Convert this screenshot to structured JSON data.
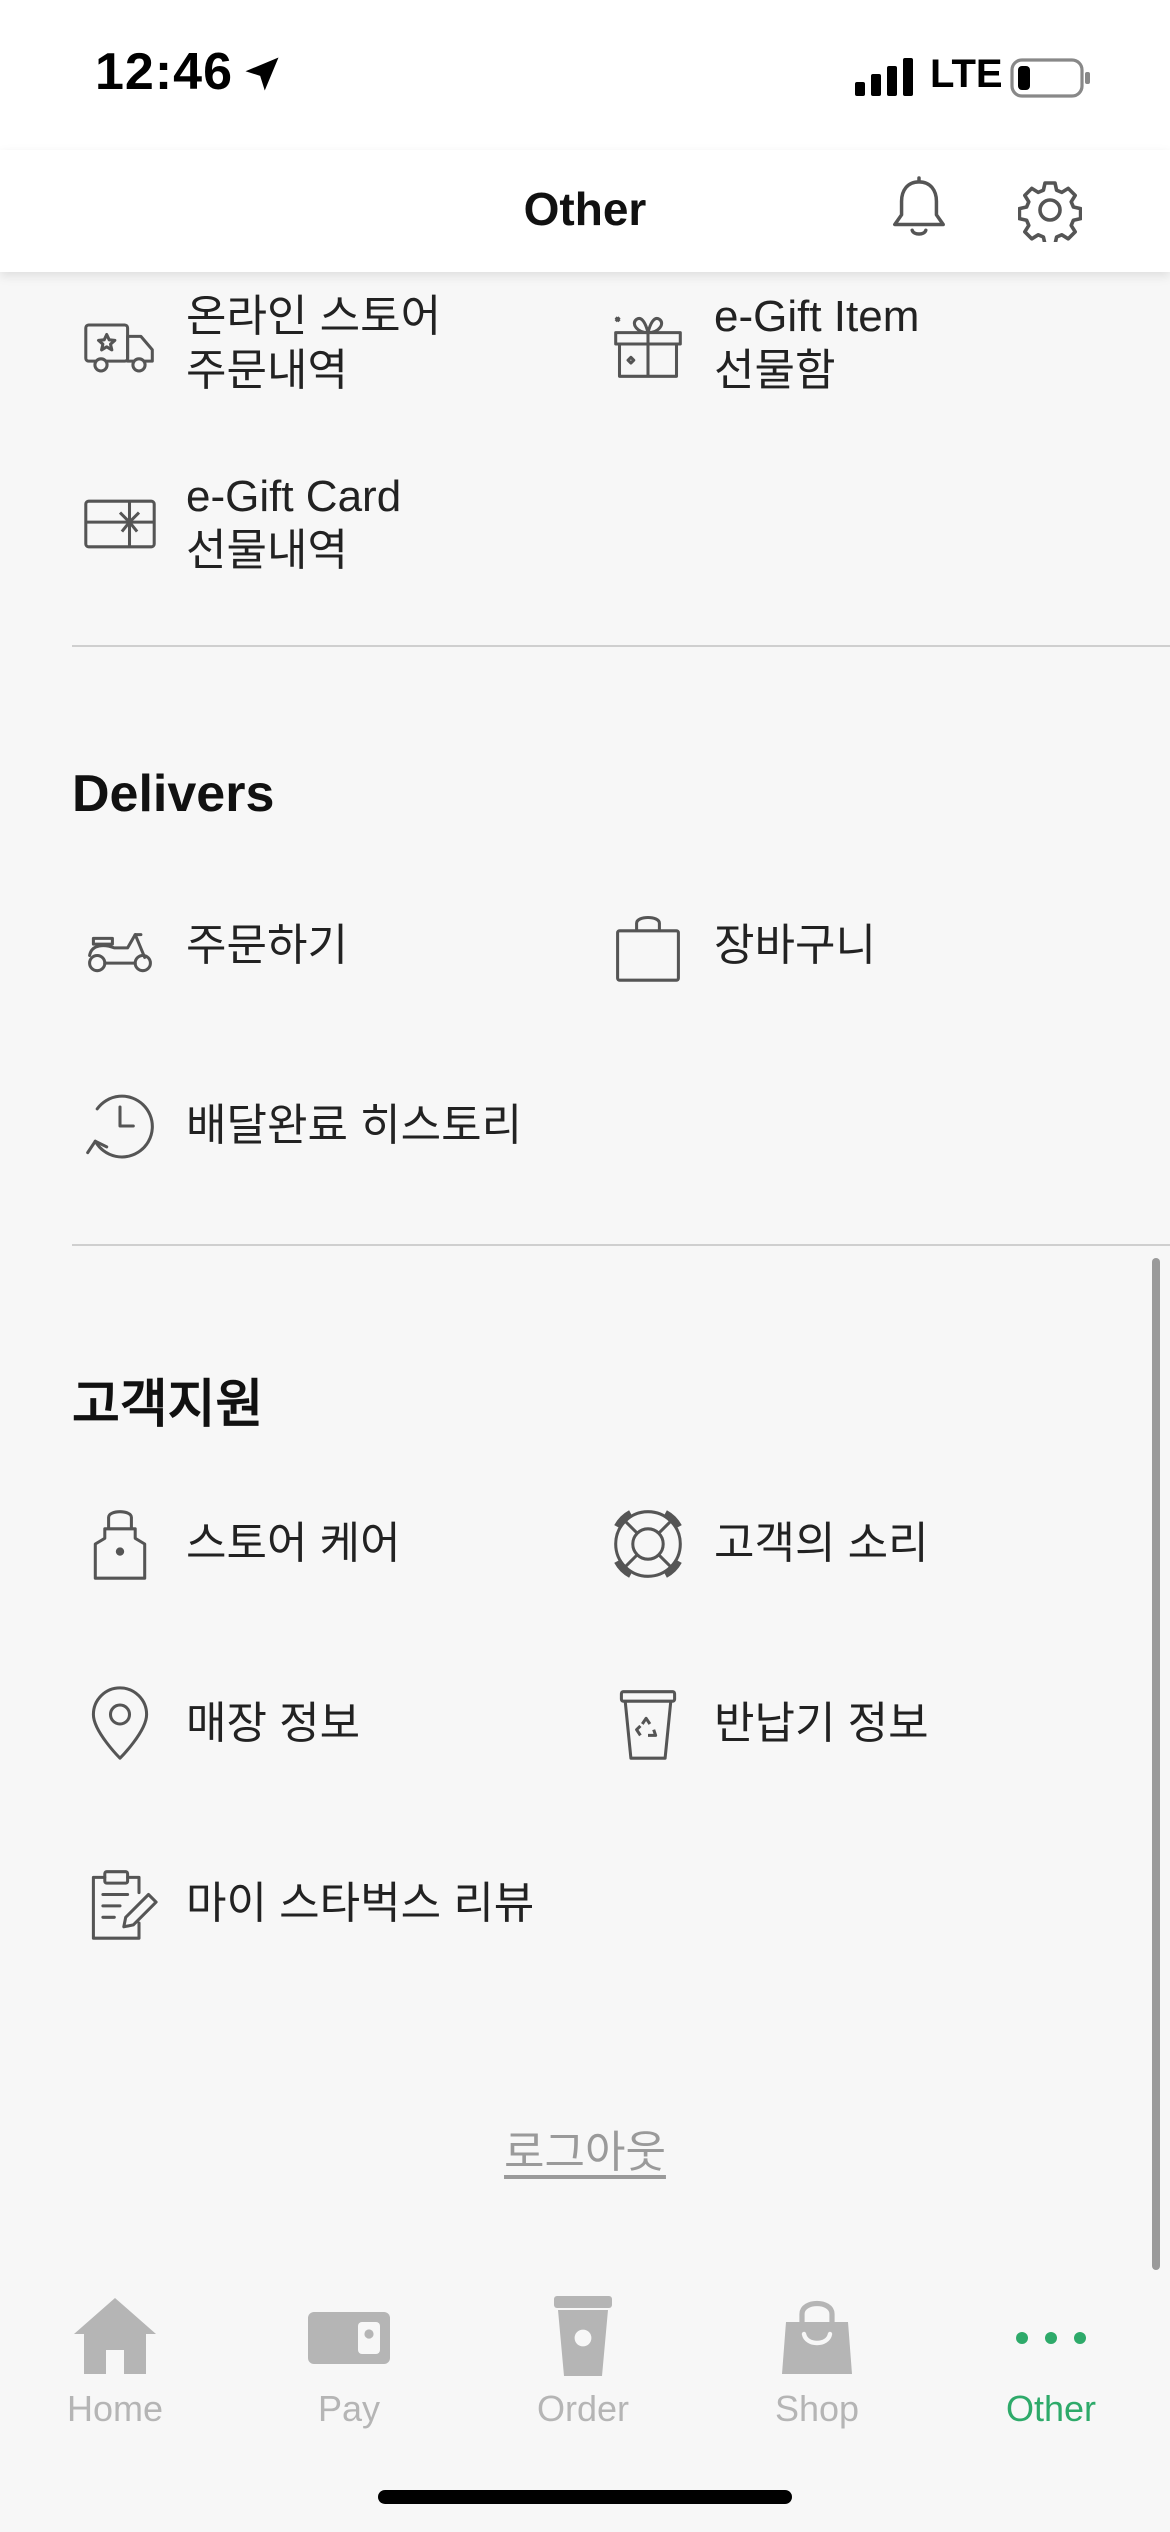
{
  "status": {
    "time": "12:46",
    "network": "LTE"
  },
  "header": {
    "title": "Other"
  },
  "orders_section": {
    "items": [
      {
        "icon": "delivery-truck-icon",
        "lines": [
          "온라인 스토어",
          "주문내역"
        ]
      },
      {
        "icon": "gift-box-icon",
        "lines": [
          "e-Gift Item",
          "선물함"
        ]
      },
      {
        "icon": "gift-card-icon",
        "lines": [
          "e-Gift Card",
          "선물내역"
        ]
      }
    ]
  },
  "delivers_section": {
    "title": "Delivers",
    "items": [
      {
        "icon": "scooter-icon",
        "label": "주문하기"
      },
      {
        "icon": "shopping-bag-icon",
        "label": "장바구니"
      },
      {
        "icon": "history-clock-icon",
        "label": "배달완료 히스토리"
      }
    ]
  },
  "support_section": {
    "title": "고객지원",
    "items": [
      {
        "icon": "apron-icon",
        "label": "스토어 케어"
      },
      {
        "icon": "lifebuoy-icon",
        "label": "고객의 소리"
      },
      {
        "icon": "location-pin-icon",
        "label": "매장 정보"
      },
      {
        "icon": "recycle-cup-icon",
        "label": "반납기 정보"
      },
      {
        "icon": "review-clipboard-icon",
        "label": "마이 스타벅스 리뷰"
      }
    ]
  },
  "logout_label": "로그아웃",
  "tabs": [
    {
      "label": "Home",
      "icon": "home-icon",
      "active": false
    },
    {
      "label": "Pay",
      "icon": "card-icon",
      "active": false
    },
    {
      "label": "Order",
      "icon": "cup-icon",
      "active": false
    },
    {
      "label": "Shop",
      "icon": "bag-icon",
      "active": false
    },
    {
      "label": "Other",
      "icon": "more-dots-icon",
      "active": true
    }
  ],
  "colors": {
    "accent": "#2eaa6a",
    "tab_inactive": "#b5b5b5",
    "background": "#f7f7f7"
  }
}
